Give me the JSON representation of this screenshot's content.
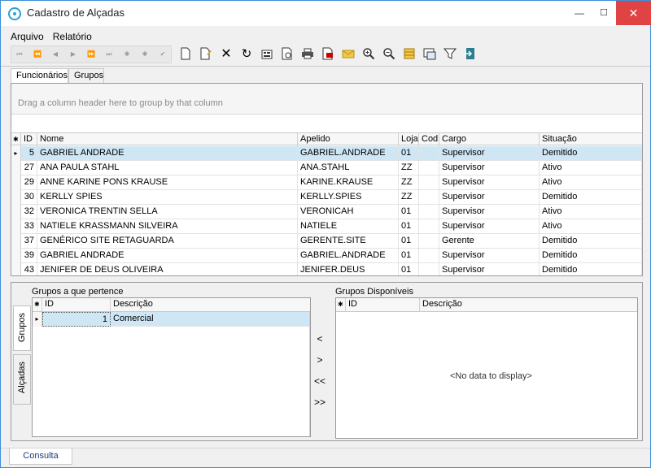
{
  "window": {
    "title": "Cadastro de Alçadas",
    "min": "—",
    "max": "☐",
    "close": "✕"
  },
  "menu": [
    {
      "label": "Arquivo"
    },
    {
      "label": "Relatório"
    }
  ],
  "navigator": [
    "⏮",
    "⏪",
    "◀",
    "▶",
    "⏩",
    "⏭",
    "✱",
    "✱",
    "✔"
  ],
  "toolbar_icons": [
    "new-document-icon",
    "edit-document-icon",
    "delete-icon",
    "refresh-icon",
    "properties-icon",
    "preview-icon",
    "print-icon",
    "export-pdf-icon",
    "email-icon",
    "zoom-in-icon",
    "zoom-out-icon",
    "layout-icon",
    "columns-icon",
    "filter-icon",
    "exit-icon"
  ],
  "tabs": [
    {
      "label": "Funcionários"
    },
    {
      "label": "Grupos"
    }
  ],
  "grid": {
    "groupby_hint": "Drag a column header here to group by that column",
    "indicator": "✱",
    "columns": [
      "ID",
      "Nome",
      "Apelido",
      "Loja",
      "Cod",
      "Cargo",
      "Situação"
    ],
    "rows": [
      {
        "id": "5",
        "nome": "GABRIEL ANDRADE",
        "apelido": "GABRIEL.ANDRADE",
        "loja": "01",
        "cod": "",
        "cargo": "Supervisor",
        "situacao": "Demitido"
      },
      {
        "id": "27",
        "nome": "ANA PAULA STAHL",
        "apelido": "ANA.STAHL",
        "loja": "ZZ",
        "cod": "",
        "cargo": "Supervisor",
        "situacao": "Ativo"
      },
      {
        "id": "29",
        "nome": "ANNE KARINE PONS KRAUSE",
        "apelido": "KARINE.KRAUSE",
        "loja": "ZZ",
        "cod": "",
        "cargo": "Supervisor",
        "situacao": "Ativo"
      },
      {
        "id": "30",
        "nome": "KERLLY SPIES",
        "apelido": "KERLLY.SPIES",
        "loja": "ZZ",
        "cod": "",
        "cargo": "Supervisor",
        "situacao": "Demitido"
      },
      {
        "id": "32",
        "nome": "VERONICA TRENTIN SELLA",
        "apelido": "VERONICAH",
        "loja": "01",
        "cod": "",
        "cargo": "Supervisor",
        "situacao": "Ativo"
      },
      {
        "id": "33",
        "nome": "NATIELE KRASSMANN SILVEIRA",
        "apelido": "NATIELE",
        "loja": "01",
        "cod": "",
        "cargo": "Supervisor",
        "situacao": "Ativo"
      },
      {
        "id": "37",
        "nome": "GENÉRICO SITE RETAGUARDA",
        "apelido": "GERENTE.SITE",
        "loja": "01",
        "cod": "",
        "cargo": "Gerente",
        "situacao": "Demitido"
      },
      {
        "id": "39",
        "nome": "GABRIEL ANDRADE",
        "apelido": "GABRIEL.ANDRADE",
        "loja": "01",
        "cod": "",
        "cargo": "Supervisor",
        "situacao": "Demitido"
      },
      {
        "id": "43",
        "nome": "JENIFER DE DEUS OLIVEIRA",
        "apelido": "JENIFER.DEUS",
        "loja": "01",
        "cod": "",
        "cargo": "Supervisor",
        "situacao": "Demitido"
      }
    ]
  },
  "side_tabs": [
    {
      "label": "Grupos"
    },
    {
      "label": "Alçadas"
    }
  ],
  "grupos_pertence": {
    "title": "Grupos a que pertence",
    "columns": [
      "ID",
      "Descrição"
    ],
    "rows": [
      {
        "id": "1",
        "descricao": "Comercial"
      }
    ]
  },
  "transfer_buttons": [
    "<",
    ">",
    "<<",
    ">>"
  ],
  "grupos_disponiveis": {
    "title": "Grupos Disponíveis",
    "columns": [
      "ID",
      "Descrição"
    ],
    "empty_text": "<No data to display>"
  },
  "status_tab": "Consulta"
}
